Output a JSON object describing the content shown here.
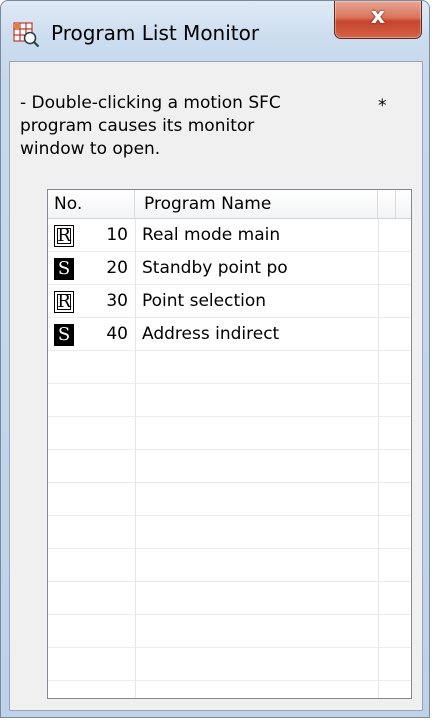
{
  "window": {
    "title": "Program List Monitor",
    "icon": "program-list-monitor-icon",
    "close_label": "x"
  },
  "instruction": {
    "text": "- Double-clicking a motion SFC program causes its monitor window to open.",
    "asterisk": "*"
  },
  "table": {
    "columns": [
      "No.",
      "Program Name"
    ],
    "rows": [
      {
        "type": "R",
        "mode": "real-mode",
        "number": "10",
        "name": "Real mode main"
      },
      {
        "type": "S",
        "mode": "standby",
        "number": "20",
        "name": "Standby point po"
      },
      {
        "type": "R",
        "mode": "real-mode",
        "number": "30",
        "name": "Point selection"
      },
      {
        "type": "S",
        "mode": "standby",
        "number": "40",
        "name": "Address indirect"
      }
    ],
    "empty_rows": 10
  },
  "colors": {
    "title_bar": "#cbdcef",
    "close_button": "#c5442c",
    "client_background": "#f0f0f0",
    "list_background": "#ffffff"
  }
}
